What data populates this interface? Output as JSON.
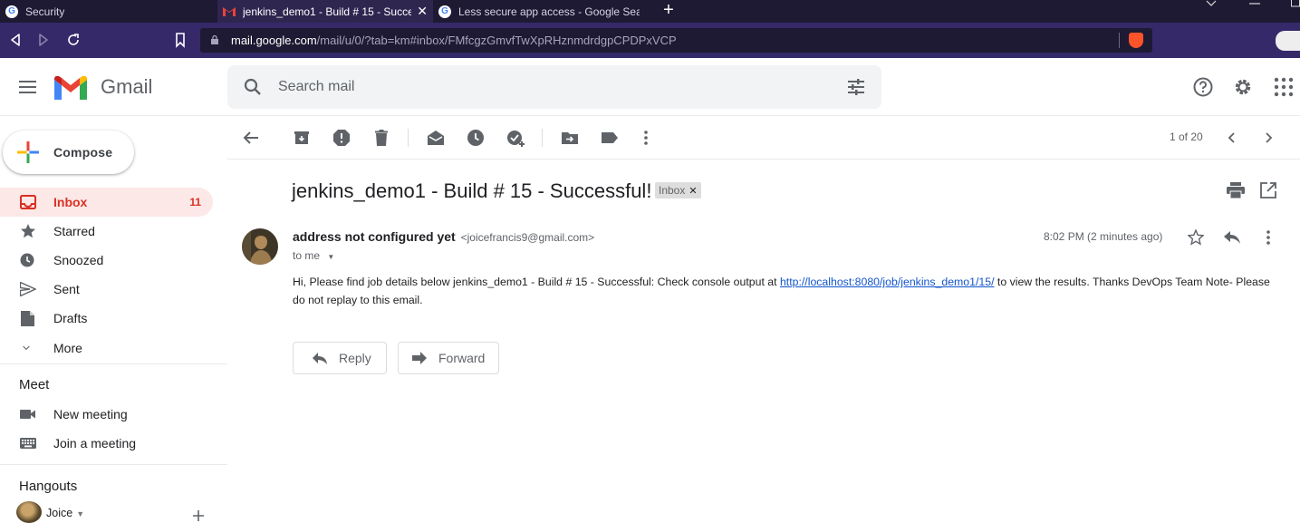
{
  "browser": {
    "tabs": [
      {
        "label": "Security",
        "active": false
      },
      {
        "label": "jenkins_demo1 - Build # 15 - Succe",
        "active": true
      },
      {
        "label": "Less secure app access - Google Searc",
        "active": false
      }
    ],
    "url_host": "mail.google.com",
    "url_path": "/mail/u/0/?tab=km#inbox/FMfcgzGmvfTwXpRHznmdrdgpCPDPxVCP"
  },
  "header": {
    "app_name": "Gmail",
    "search_placeholder": "Search mail"
  },
  "sidebar": {
    "compose_label": "Compose",
    "items": [
      {
        "label": "Inbox",
        "count": "11",
        "icon": "inbox-icon",
        "active": true
      },
      {
        "label": "Starred",
        "count": "",
        "icon": "star-icon",
        "active": false
      },
      {
        "label": "Snoozed",
        "count": "",
        "icon": "clock-icon",
        "active": false
      },
      {
        "label": "Sent",
        "count": "",
        "icon": "send-icon",
        "active": false
      },
      {
        "label": "Drafts",
        "count": "",
        "icon": "draft-icon",
        "active": false
      },
      {
        "label": "More",
        "count": "",
        "icon": "chevron-down-icon",
        "active": false
      }
    ],
    "meet": {
      "title": "Meet",
      "items": [
        {
          "label": "New meeting",
          "icon": "video-icon"
        },
        {
          "label": "Join a meeting",
          "icon": "keyboard-icon"
        }
      ]
    },
    "hangouts": {
      "title": "Hangouts",
      "user": "Joice"
    }
  },
  "toolbar": {
    "pager": "1 of 20"
  },
  "message": {
    "subject": "jenkins_demo1 - Build # 15 - Successful!",
    "label": "Inbox",
    "sender_name": "address not configured yet",
    "sender_email": "<joicefrancis9@gmail.com>",
    "to": "to me",
    "time": "8:02 PM (2 minutes ago)",
    "body_pre": "Hi, Please find job details below jenkins_demo1 - Build # 15 - Successful: Check console output at ",
    "body_link": "http://localhost:8080/job/jenkins_demo1/15/",
    "body_post": " to view the results. Thanks DevOps Team Note- Please do not replay to this email.",
    "reply_label": "Reply",
    "forward_label": "Forward"
  },
  "colors": {
    "accent_red": "#d93025",
    "active_bg": "#fce8e6",
    "link": "#1155cc",
    "browser_tabbar": "#1f1a33",
    "browser_toolbar": "#35296a"
  }
}
